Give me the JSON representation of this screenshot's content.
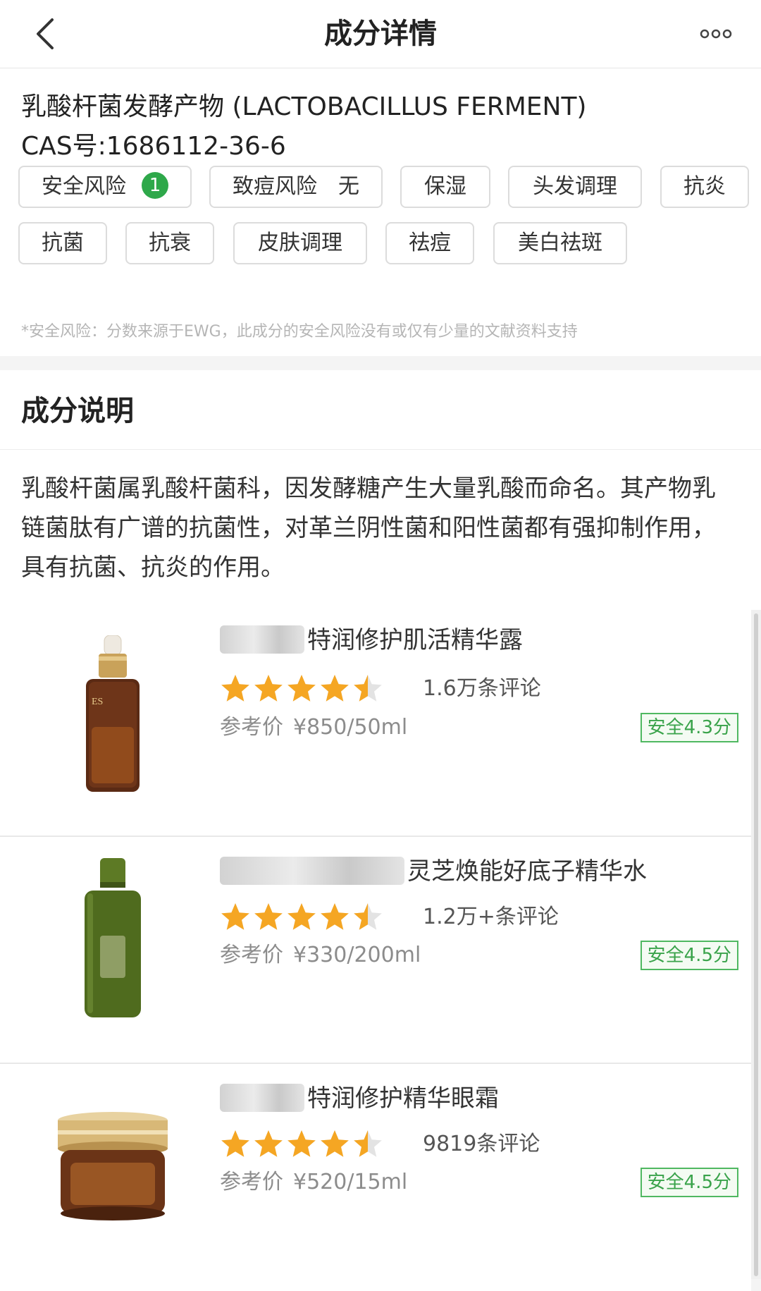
{
  "navbar": {
    "title": "成分详情"
  },
  "ingredient": {
    "name": "乳酸杆菌发酵产物 (LACTOBACILLUS FERMENT)",
    "cas_label": "CAS号:",
    "cas_number": "1686112-36-6"
  },
  "tags": {
    "safety_risk": {
      "label": "安全风险",
      "value": "1"
    },
    "acne_risk": {
      "label": "致痘风险",
      "value": "无"
    },
    "items": [
      "保湿",
      "头发调理",
      "抗炎",
      "抗菌",
      "抗衰",
      "皮肤调理",
      "祛痘",
      "美白祛斑"
    ]
  },
  "footnote": "*安全风险：分数来源于EWG，此成分的安全风险没有或仅有少量的文献资料支持",
  "description": {
    "heading": "成分说明",
    "text": "乳酸杆菌属乳酸杆菌科，因发酵糖产生大量乳酸而命名。其产物乳链菌肽有广谱的抗菌性，对革兰阴性菌和阳性菌都有强抑制作用，具有抗菌、抗炎的作用。"
  },
  "products": [
    {
      "name": "特润修护肌活精华露",
      "rating": 4.5,
      "reviews": "1.6万条评论",
      "price_label": "参考价",
      "price": "¥850/50ml",
      "safety": "安全4.3分",
      "icon": "amber-serum-bottle-image",
      "colors": {
        "body": "#5a2a14",
        "cap": "#c9a25a"
      }
    },
    {
      "name": "灵芝焕能好底子精华水",
      "rating": 4.5,
      "reviews": "1.2万+条评论",
      "price_label": "参考价",
      "price": "¥330/200ml",
      "safety": "安全4.5分",
      "icon": "green-toner-bottle-image",
      "colors": {
        "body": "#4f6b1e",
        "cap": "#5d7a25"
      }
    },
    {
      "name": "特润修护精华眼霜",
      "rating": 4.5,
      "reviews": "9819条评论",
      "price_label": "参考价",
      "price": "¥520/15ml",
      "safety": "安全4.5分",
      "icon": "eye-cream-jar-image",
      "colors": {
        "body": "#6b3417",
        "cap": "#c9a25a"
      }
    }
  ],
  "colors": {
    "accent_green": "#2ea84a",
    "star_orange": "#f5a623",
    "safety_green": "#3aa34b"
  }
}
